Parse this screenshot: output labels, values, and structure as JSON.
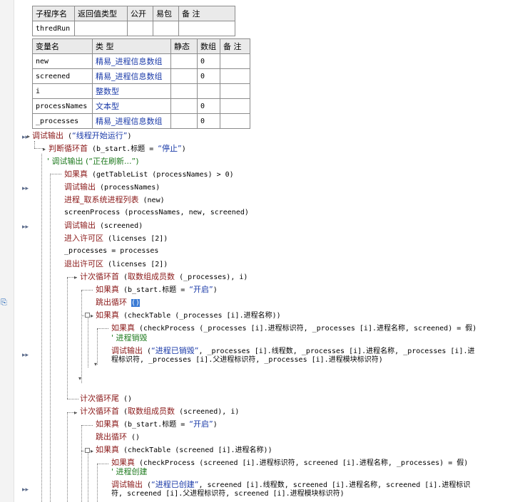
{
  "sub_table": {
    "headers": [
      "子程序名",
      "返回值类型",
      "公开",
      "易包",
      "备 注"
    ],
    "row": [
      "thredRun",
      "",
      "",
      "",
      ""
    ]
  },
  "var_table": {
    "headers": [
      "变量名",
      "类 型",
      "静态",
      "数组",
      "备 注"
    ],
    "rows": [
      {
        "name": "new",
        "type": "精易_进程信息数组",
        "static": "",
        "array": "0",
        "note": ""
      },
      {
        "name": "screened",
        "type": "精易_进程信息数组",
        "static": "",
        "array": "0",
        "note": ""
      },
      {
        "name": "i",
        "type": "整数型",
        "static": "",
        "array": "",
        "note": ""
      },
      {
        "name": "processNames",
        "type": "文本型",
        "static": "",
        "array": "0",
        "note": ""
      },
      {
        "name": "_processes",
        "type": "精易_进程信息数组",
        "static": "",
        "array": "0",
        "note": ""
      }
    ]
  },
  "code": {
    "l1": {
      "kw": "调试输出",
      "a": " (",
      "s": "“线程开始运行”",
      "b": ")"
    },
    "l2": {
      "kw": "判断循环首",
      "a": " (b_start.标题 = ",
      "s": "“停止”",
      "b": ")"
    },
    "l3": {
      "c1": "' 调试输出",
      "c2": " (“正在刷新...”)"
    },
    "l4": {
      "kw": "如果真",
      "a": " (getTableList (processNames) > 0)"
    },
    "l5": {
      "kw": "调试输出",
      "a": " (processNames)"
    },
    "l6": {
      "kw": "进程_取系统进程列表",
      "a": " (new)"
    },
    "l7": {
      "a": "screenProcess (processNames, new, screened)"
    },
    "l8": {
      "kw": "调试输出",
      "a": " (screened)"
    },
    "l9": {
      "kw": "进入许可区",
      "a": " (licenses [2])"
    },
    "l10": {
      "a": "_processes = processes"
    },
    "l11": {
      "kw": "退出许可区",
      "a": " (licenses [2])"
    },
    "l12": {
      "kw": "计次循环首",
      "a": " (",
      "kw2": "取数组成员数",
      "b": " (_processes), i)"
    },
    "l13": {
      "kw": "如果真",
      "a": " (b_start.标题 = ",
      "s": "“开启”",
      "b": ")"
    },
    "l14": {
      "kw": "跳出循环",
      "a": " ",
      "sel": "()"
    },
    "l15": {
      "kw": "如果真",
      "a": " (checkTable (_processes [i].进程名称))"
    },
    "l16": {
      "kw": "如果真",
      "a": " (checkProcess (_processes [i].进程标识符, _processes [i].进程名称, screened) = 假)"
    },
    "l17": {
      "c": "' 进程销毁"
    },
    "l18": {
      "kw": "调试输出",
      "a": " (",
      "s": "“进程已销毁”",
      "b": ", _processes [i].线程数, _processes [i].进程名称, _processes [i].进"
    },
    "l18b": {
      "a": "程标识符, _processes [i].父进程标识符, _processes [i].进程模块标识符)"
    },
    "l19": {
      "kw": "计次循环尾",
      "a": " ()"
    },
    "l20": {
      "kw": "计次循环首",
      "a": " (",
      "kw2": "取数组成员数",
      "b": " (screened), i)"
    },
    "l21": {
      "kw": "如果真",
      "a": " (b_start.标题 = ",
      "s": "“开启”",
      "b": ")"
    },
    "l22": {
      "kw": "跳出循环",
      "a": " ()"
    },
    "l23": {
      "kw": "如果真",
      "a": " (checkTable (screened [i].进程名称))"
    },
    "l24": {
      "kw": "如果真",
      "a": " (checkProcess (screened [i].进程标识符, screened [i].进程名称, _processes) = 假)"
    },
    "l25": {
      "c": "' 进程创建"
    },
    "l26": {
      "kw": "调试输出",
      "a": " (",
      "s": "“进程已创建”",
      "b": ", screened [i].线程数, screened [i].进程名称, screened [i].进程标识"
    },
    "l26b": {
      "a": "符, screened [i].父进程标识符, screened [i].进程模块标识符)"
    }
  },
  "icons": {
    "breakpoint": "run-marker-icon",
    "sidebar": "link-icon"
  }
}
